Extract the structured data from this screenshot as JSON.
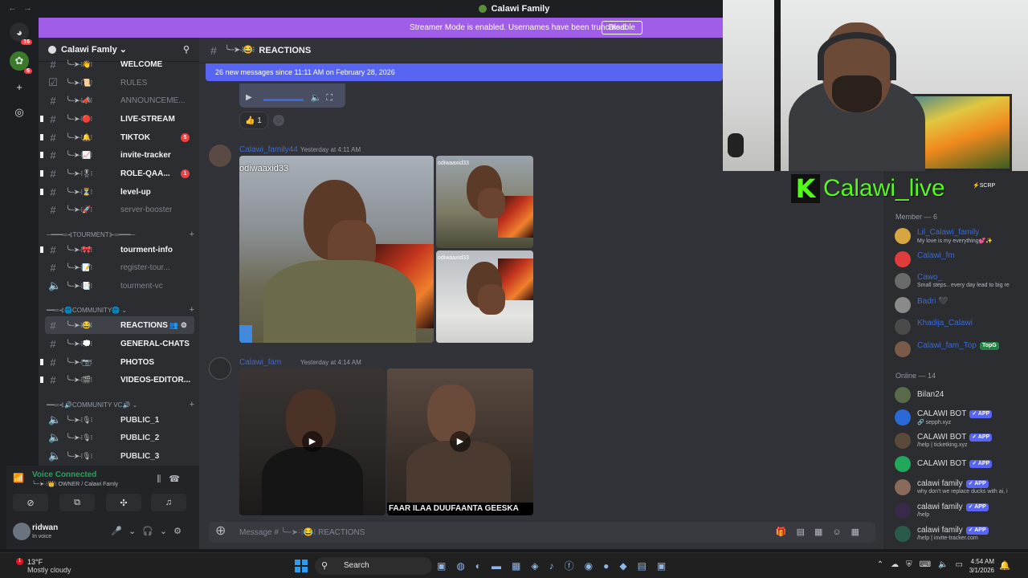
{
  "window": {
    "title": "Calawi Family"
  },
  "banner": {
    "message": "Streamer Mode is enabled. Usernames have been truncated.",
    "disable_label": "Disable"
  },
  "rail": {
    "badge_top": "16",
    "badge_server": "6"
  },
  "sidebar": {
    "guild_name": "Calawi Famly ⌄",
    "channels": [
      {
        "name": "WELCOME",
        "deco": "╰─➤·⁝👋⁝"
      },
      {
        "name": "RULES",
        "deco": "╰─➤·⁝📜⁝",
        "muted": true
      },
      {
        "name": "ANNOUNCEME...",
        "deco": "╰─➤·⁝📣⁝",
        "muted": true
      },
      {
        "name": "LIVE-STREAM",
        "deco": "╰─➤·⁝🔴⁝"
      },
      {
        "name": "TIKTOK",
        "deco": "╰─➤·⁝🔔⁝",
        "badge": "5"
      },
      {
        "name": "invite-tracker",
        "deco": "╰─➤·⁝📈⁝"
      },
      {
        "name": "ROLE-QAA...",
        "deco": "╰─➤·⁝🎖⁝",
        "badge": "1"
      },
      {
        "name": "level-up",
        "deco": "╰─➤·⁝⏳⁝"
      },
      {
        "name": "server-booster",
        "deco": "╰─➤·⁝🚀⁝",
        "muted": true
      }
    ],
    "cat_tourment": "─━━━═⊰TOURMENT⊱═━━━─",
    "tourment_channels": [
      {
        "name": "tourment-info",
        "deco": "╰─➤·⁝🎀⁝"
      },
      {
        "name": "register-tour...",
        "deco": "╰─➤·⁝📝⁝",
        "muted": true
      },
      {
        "name": "tourment-vc",
        "deco": "╰─➤·⁝📑⁝",
        "muted": true
      }
    ],
    "cat_community": "━━═⊰🌐COMMUNITY🌐 ⌄",
    "community_channels": [
      {
        "name": "REACTIONS",
        "deco": "╰─➤·⁝😂⁝",
        "active": true
      },
      {
        "name": "GENERAL-CHATS",
        "deco": "╰─➤·⁝💭⁝"
      },
      {
        "name": "PHOTOS",
        "deco": "╰─➤·⁝📷⁝"
      },
      {
        "name": "VIDEOS-EDITOR...",
        "deco": "╰─➤·⁝🎬⁝"
      }
    ],
    "cat_vc": "━━═⊰🔊COMMUNITY VC🔊 ⌄",
    "vc_channels": [
      {
        "name": "PUBLIC_1",
        "deco": "╰─➤·⁝🎙⁝"
      },
      {
        "name": "PUBLIC_2",
        "deco": "╰─➤·⁝🎙⁝"
      },
      {
        "name": "PUBLIC_3",
        "deco": "╰─➤·⁝🎙⁝"
      }
    ]
  },
  "voice": {
    "status": "Voice Connected",
    "channel": "╰─➤·⁝👑⁝ OWNER / Calawi Famly"
  },
  "user": {
    "name": "ridwan",
    "status": "In voice"
  },
  "main": {
    "channel_deco": "╰─➤·⁝😂⁝",
    "channel_name": "REACTIONS",
    "new_messages": "26 new messages since 11:11 AM on February 28, 2026",
    "reaction_count": "1",
    "msg1": {
      "author": "Calawi_family44",
      "time": "Yesterday at 4:11 AM",
      "watermark": "odiwaaxid33",
      "watermark_small": "odiwaaxid33"
    },
    "msg2": {
      "author": "Calawi_fam",
      "time": "Yesterday at 4:14 AM",
      "caption": "FAAR ILAA DUUFAANTA GEESKA"
    },
    "composer_placeholder": "Message # ╰─➤·⁝😂⁝  REACTIONS"
  },
  "members": {
    "section_members": "Member — 6",
    "section_online": "Online — 14",
    "list_members": [
      {
        "name": "Lil_Calawi_family",
        "sub": "My love is my everything💕✨",
        "color": "#d7a642",
        "blue": true
      },
      {
        "name": "Calawi_fm",
        "sub": "",
        "color": "#e03c3c",
        "blue": true
      },
      {
        "name": "Cawo_",
        "sub": "Small steps.. every day lead to big re",
        "color": "#6a6a6a",
        "blue": true
      },
      {
        "name": "Badri 🖤",
        "sub": "",
        "color": "#8a8a8a",
        "blue": true
      },
      {
        "name": "Khadija_Calawi",
        "sub": "",
        "color": "#4a4a4a",
        "blue": true
      },
      {
        "name": "Calawi_fam_Top",
        "sub": "",
        "color": "#7a5a48",
        "blue": true,
        "tag": "TopG"
      }
    ],
    "list_online": [
      {
        "name": "Bilan24",
        "sub": "",
        "color": "#5a6a4a"
      },
      {
        "name": "CALAWI BOT",
        "sub": "🔗 sepph.xyz",
        "color": "#2a6ad6",
        "tag": "✓ APP"
      },
      {
        "name": "CALAWI BOT",
        "sub": "/help | ticketking.xyz",
        "color": "#5a4a3a",
        "tag": "✓ APP"
      },
      {
        "name": "CALAWI BOT",
        "sub": "",
        "color": "#22a85a",
        "tag": "✓ APP"
      },
      {
        "name": "calawi family",
        "sub": "why don't we replace ducks with ai, i",
        "color": "#8a6a5a",
        "tag": "✓ APP"
      },
      {
        "name": "calawi family",
        "sub": "/help",
        "color": "#3a2a4a",
        "tag": "✓ APP"
      },
      {
        "name": "calawi family",
        "sub": "/help | invite-tracker.com",
        "color": "#2a5a4a",
        "tag": "✓ APP"
      }
    ]
  },
  "overlay": {
    "brand_letter": "K",
    "brand_name": "Calawi_live",
    "scrp": "⚡SCRP"
  },
  "taskbar": {
    "temp": "13°F",
    "weather": "Mostly cloudy",
    "weather_badge": "1",
    "search": "Search",
    "time": "4:54 AM",
    "date": "3/1/2026"
  },
  "colors": {
    "accent": "#5865f2",
    "banner": "#a05ee8",
    "kick_green": "#53fc18",
    "online": "#23a55a"
  }
}
